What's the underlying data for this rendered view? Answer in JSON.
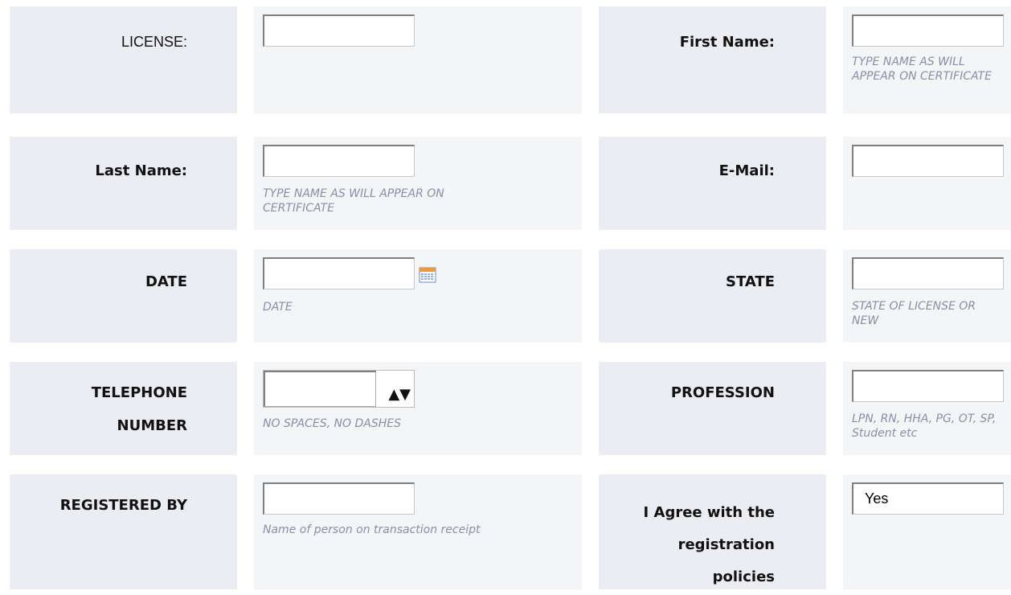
{
  "rows": [
    {
      "left_label": "LICENSE:",
      "left_hint": "",
      "right_label": "First Name:",
      "right_hint": "TYPE NAME AS WILL APPEAR ON CERTIFICATE"
    },
    {
      "left_label": "Last Name:",
      "left_hint": "TYPE NAME AS WILL APPEAR ON CERTIFICATE",
      "right_label": "E-Mail:",
      "right_hint": ""
    },
    {
      "left_label": "DATE",
      "left_hint": "DATE",
      "right_label": "STATE",
      "right_hint": "STATE OF LICENSE OR NEW"
    },
    {
      "left_label_line1": "TELEPHONE",
      "left_label_line2": "NUMBER",
      "left_hint": "NO SPACES, NO DASHES",
      "spinner_arrows": "▲▼",
      "right_label": "PROFESSION",
      "right_hint": "LPN, RN, HHA, PG, OT, SP, Student etc"
    },
    {
      "left_label": "REGISTERED BY",
      "left_hint": "Name of person on transaction receipt",
      "right_label_line1": "I Agree with the",
      "right_label_line2": "registration",
      "right_label_line3": "policies",
      "agree_value": "Yes"
    }
  ],
  "icons": {
    "date_picker": "calendar-icon"
  },
  "colors": {
    "label_bg": "#ebedf2",
    "field_bg": "#f4f5f7",
    "hint": "#8a8fa6"
  }
}
